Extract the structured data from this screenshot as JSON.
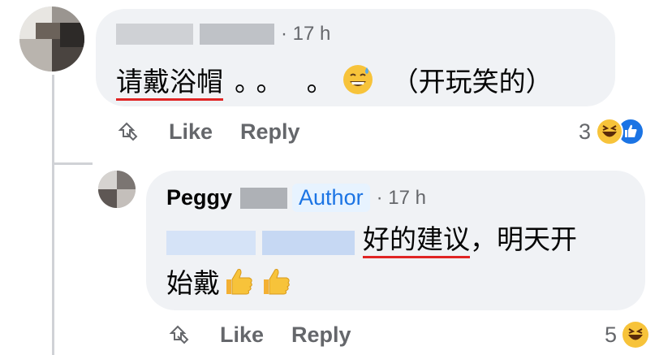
{
  "comment": {
    "time": "· 17 h",
    "text": "请戴浴帽",
    "dots": "。。 。",
    "joke": "（开玩笑的）",
    "like_label": "Like",
    "reply_label": "Reply",
    "reaction_count": "3",
    "reaction_icons": [
      "laughing-emoji",
      "thumbs-up-blue"
    ]
  },
  "reply": {
    "author_name": "Peggy",
    "author_badge": "Author",
    "time": "· 17 h",
    "text_underlined": "好的建议",
    "text_rest": "，明天开",
    "line2": "始戴",
    "like_label": "Like",
    "reply_label": "Reply",
    "reaction_count": "5",
    "reaction_icons": [
      "laughing-emoji"
    ]
  },
  "colors": {
    "bubble": "#f0f2f5",
    "meta": "#65676b",
    "badge_bg": "#e7f3ff",
    "badge_text": "#1b74e4",
    "underline": "#e02424"
  }
}
